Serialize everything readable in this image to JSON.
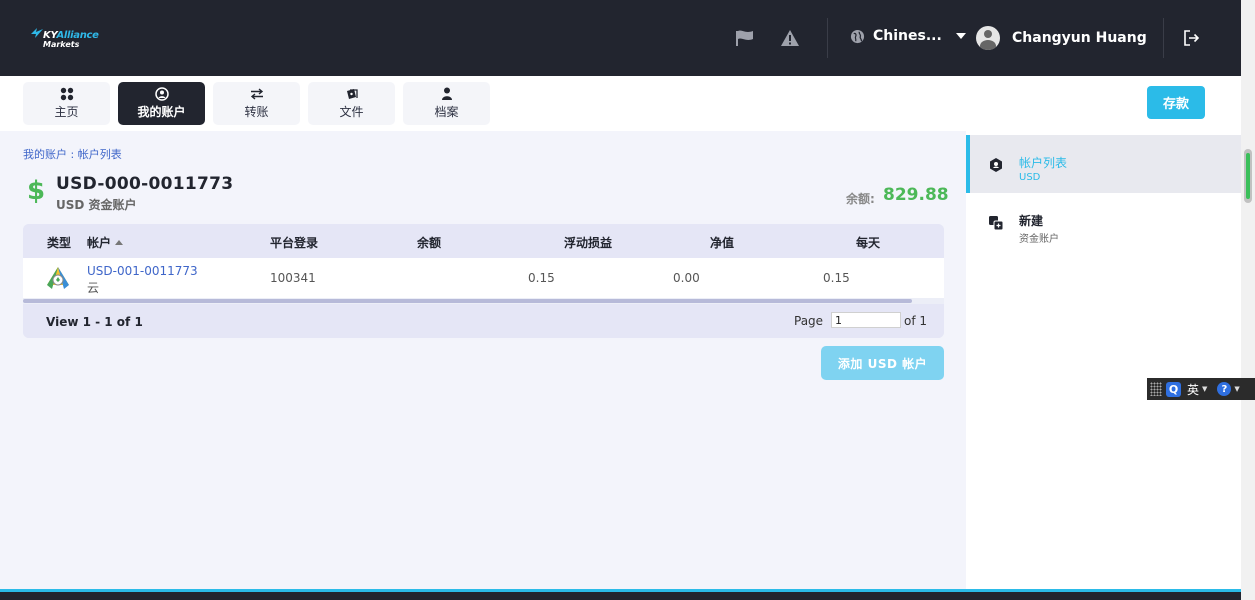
{
  "header": {
    "logo_line1_a": "KY",
    "logo_line1_b": "Alliance",
    "logo_line2": "Markets",
    "language": "Chines...",
    "user_name": "Changyun Huang"
  },
  "nav": {
    "tabs": [
      {
        "label": "主页",
        "icon": "grid-icon"
      },
      {
        "label": "我的账户",
        "icon": "user-circle-icon"
      },
      {
        "label": "转账",
        "icon": "transfer-arrows-icon"
      },
      {
        "label": "文件",
        "icon": "documents-icon"
      },
      {
        "label": "档案",
        "icon": "person-icon"
      }
    ],
    "active_tab": 1,
    "deposit_label": "存款"
  },
  "main": {
    "breadcrumb": "我的账户 : 帐户列表",
    "account_title": "USD-000-0011773",
    "account_subtitle": "USD 资金账户",
    "balance_label": "余额:",
    "balance_value": "829.88",
    "table": {
      "columns": [
        "类型",
        "帐户",
        "平台登录",
        "余额",
        "浮动损益",
        "净值",
        "每天"
      ],
      "rows": [
        {
          "account": "USD-001-0011773",
          "type_sub": "云",
          "login": "100341",
          "balance": "",
          "floating_pl": "0.15",
          "equity": "0.00",
          "daily": "0.15"
        }
      ],
      "view_label": "View 1 - 1 of 1",
      "page_label": "Page",
      "page_value": "1",
      "of_label": "of 1"
    },
    "add_button": "添加 USD 帐户"
  },
  "sidebar": {
    "items": [
      {
        "title": "帐户列表",
        "subtitle": "USD",
        "active": true
      },
      {
        "title": "新建",
        "subtitle": "资金账户",
        "active": false
      }
    ]
  },
  "ime": {
    "q": "Q",
    "lang": "英",
    "help": "?"
  },
  "colors": {
    "header_bg": "#22252f",
    "accent": "#2bbbe8",
    "balance_green": "#4cb858",
    "link_blue": "#3f66c9"
  }
}
